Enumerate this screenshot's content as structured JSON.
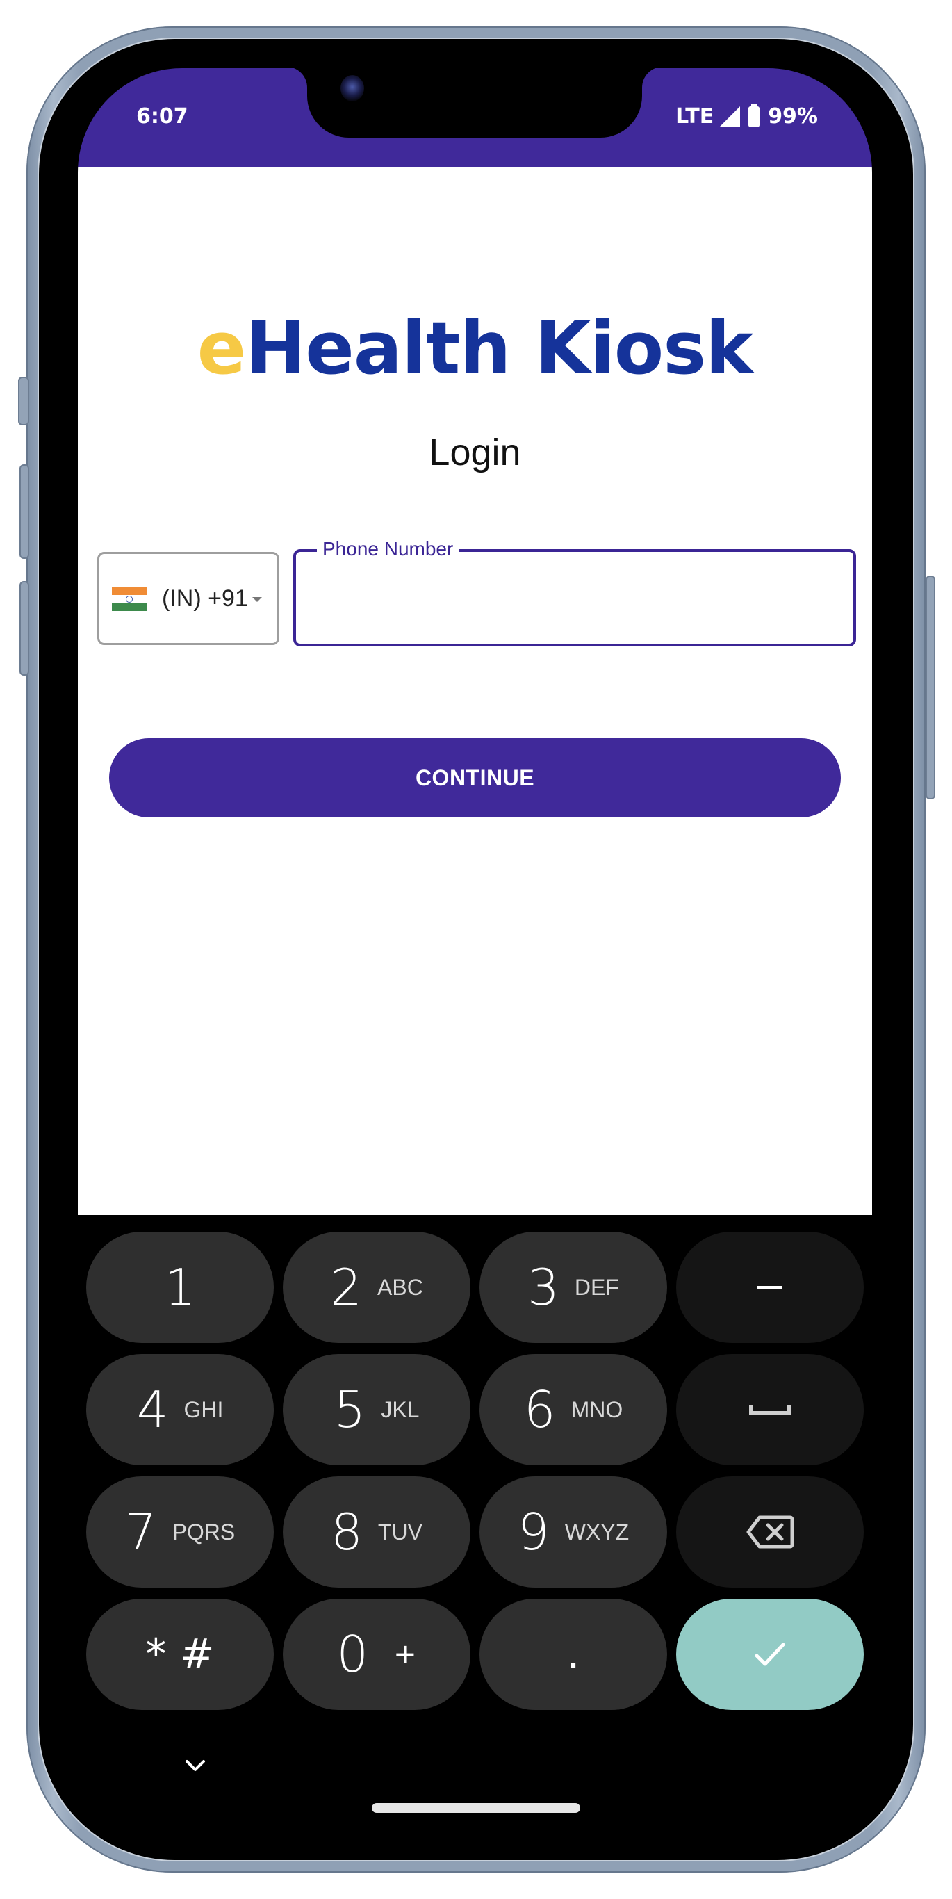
{
  "status_bar": {
    "time": "6:07",
    "network": "LTE",
    "battery": "99%",
    "icons": [
      "signal-icon",
      "battery-icon"
    ]
  },
  "app": {
    "brand_prefix": "e",
    "brand_rest": "Health Kiosk",
    "title": "Login",
    "brand_colors": {
      "prefix": "#f6c945",
      "main": "#15339a",
      "primary": "#40299a"
    }
  },
  "form": {
    "country": {
      "flag": "india-flag-icon",
      "label": "(IN) +91"
    },
    "phone": {
      "label": "Phone Number",
      "value": "",
      "placeholder": ""
    },
    "continue_label": "CONTINUE"
  },
  "keypad": {
    "rows": [
      [
        {
          "digit": "1",
          "letters": ""
        },
        {
          "digit": "2",
          "letters": "ABC"
        },
        {
          "digit": "3",
          "letters": "DEF"
        },
        {
          "icon": "minus-icon",
          "label": "-"
        }
      ],
      [
        {
          "digit": "4",
          "letters": "GHI"
        },
        {
          "digit": "5",
          "letters": "JKL"
        },
        {
          "digit": "6",
          "letters": "MNO"
        },
        {
          "icon": "space-icon",
          "label": "space"
        }
      ],
      [
        {
          "digit": "7",
          "letters": "PQRS"
        },
        {
          "digit": "8",
          "letters": "TUV"
        },
        {
          "digit": "9",
          "letters": "WXYZ"
        },
        {
          "icon": "backspace-icon",
          "label": "backspace"
        }
      ],
      [
        {
          "digit": "* #",
          "letters": ""
        },
        {
          "digit": "0",
          "letters": "+"
        },
        {
          "digit": ".",
          "letters": ""
        },
        {
          "icon": "check-icon",
          "label": "done"
        }
      ]
    ]
  },
  "nav": {
    "hide_keyboard_icon": "chevron-down-icon",
    "home_indicator": "home-indicator"
  }
}
